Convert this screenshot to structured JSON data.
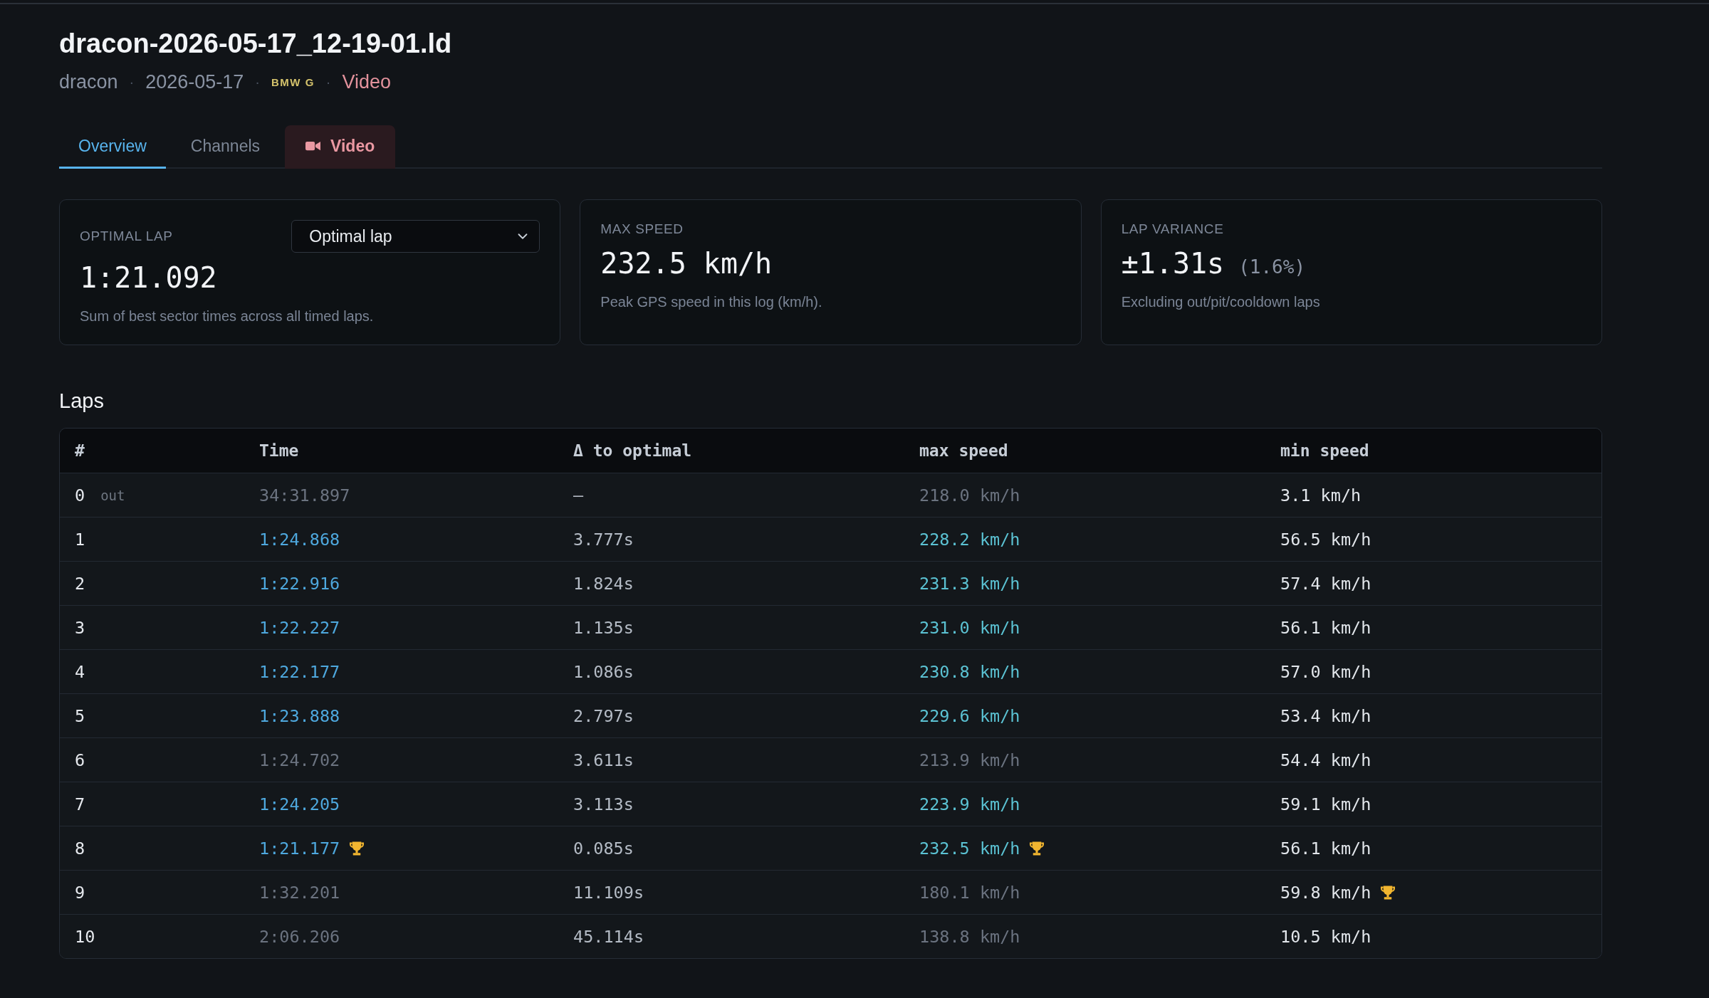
{
  "file": {
    "title": "dracon-2026-05-17_12-19-01.ld",
    "meta": [
      {
        "kind": "text",
        "text": "dracon"
      },
      {
        "kind": "text",
        "text": "2026-05-17",
        "separator": "·"
      },
      {
        "kind": "badge",
        "text": "BMW G",
        "separator": "·"
      },
      {
        "kind": "link",
        "text": "Video",
        "separator": "·"
      }
    ]
  },
  "tabs": [
    {
      "label": "Overview",
      "selected": true,
      "kind": "plain"
    },
    {
      "label": "Channels",
      "selected": false,
      "kind": "plain"
    },
    {
      "label": "Video",
      "selected": false,
      "kind": "video"
    }
  ],
  "stats": [
    {
      "kind": "select",
      "label": "OPTIMAL LAP",
      "select": {
        "value": "Optimal lap"
      },
      "value": "1:21.092",
      "description": "Sum of best sector times across all timed laps."
    },
    {
      "kind": "plain",
      "label": "MAX SPEED",
      "value": "232.5 km/h",
      "description": "Peak GPS speed in this log (km/h)."
    },
    {
      "kind": "plain",
      "label": "LAP VARIANCE",
      "value": "±1.31s",
      "note": "(1.6%)",
      "description": "Excluding out/pit/cooldown laps"
    }
  ],
  "laps": {
    "title": "Laps",
    "columns": [
      "#",
      "Time",
      "Δ to optimal",
      "max speed",
      "min speed"
    ],
    "rows": [
      {
        "lap": "0",
        "tag": "out",
        "excluded": true,
        "time": "34:31.897",
        "time_best": false,
        "delta": "—",
        "max_speed": "218.0 km/h",
        "max_best": false,
        "min_speed": "3.1 km/h",
        "min_best": false
      },
      {
        "lap": "1",
        "excluded": false,
        "time": "1:24.868",
        "time_best": false,
        "delta": "3.777s",
        "max_speed": "228.2 km/h",
        "max_best": false,
        "min_speed": "56.5 km/h",
        "min_best": false
      },
      {
        "lap": "2",
        "excluded": false,
        "time": "1:22.916",
        "time_best": false,
        "delta": "1.824s",
        "max_speed": "231.3 km/h",
        "max_best": false,
        "min_speed": "57.4 km/h",
        "min_best": false
      },
      {
        "lap": "3",
        "excluded": false,
        "time": "1:22.227",
        "time_best": false,
        "delta": "1.135s",
        "max_speed": "231.0 km/h",
        "max_best": false,
        "min_speed": "56.1 km/h",
        "min_best": false
      },
      {
        "lap": "4",
        "excluded": false,
        "time": "1:22.177",
        "time_best": false,
        "delta": "1.086s",
        "max_speed": "230.8 km/h",
        "max_best": false,
        "min_speed": "57.0 km/h",
        "min_best": false
      },
      {
        "lap": "5",
        "excluded": false,
        "time": "1:23.888",
        "time_best": false,
        "delta": "2.797s",
        "max_speed": "229.6 km/h",
        "max_best": false,
        "min_speed": "53.4 km/h",
        "min_best": false
      },
      {
        "lap": "6",
        "excluded": true,
        "time": "1:24.702",
        "time_best": false,
        "delta": "3.611s",
        "max_speed": "213.9 km/h",
        "max_best": false,
        "min_speed": "54.4 km/h",
        "min_best": false
      },
      {
        "lap": "7",
        "excluded": false,
        "time": "1:24.205",
        "time_best": false,
        "delta": "3.113s",
        "max_speed": "223.9 km/h",
        "max_best": false,
        "min_speed": "59.1 km/h",
        "min_best": false
      },
      {
        "lap": "8",
        "excluded": false,
        "time": "1:21.177",
        "time_best": true,
        "delta": "0.085s",
        "max_speed": "232.5 km/h",
        "max_best": true,
        "min_speed": "56.1 km/h",
        "min_best": false
      },
      {
        "lap": "9",
        "excluded": true,
        "time": "1:32.201",
        "time_best": false,
        "delta": "11.109s",
        "max_speed": "180.1 km/h",
        "max_best": false,
        "min_speed": "59.8 km/h",
        "min_best": true
      },
      {
        "lap": "10",
        "excluded": true,
        "time": "2:06.206",
        "time_best": false,
        "delta": "45.114s",
        "max_speed": "138.8 km/h",
        "max_best": false,
        "min_speed": "10.5 km/h",
        "min_best": false
      }
    ]
  }
}
